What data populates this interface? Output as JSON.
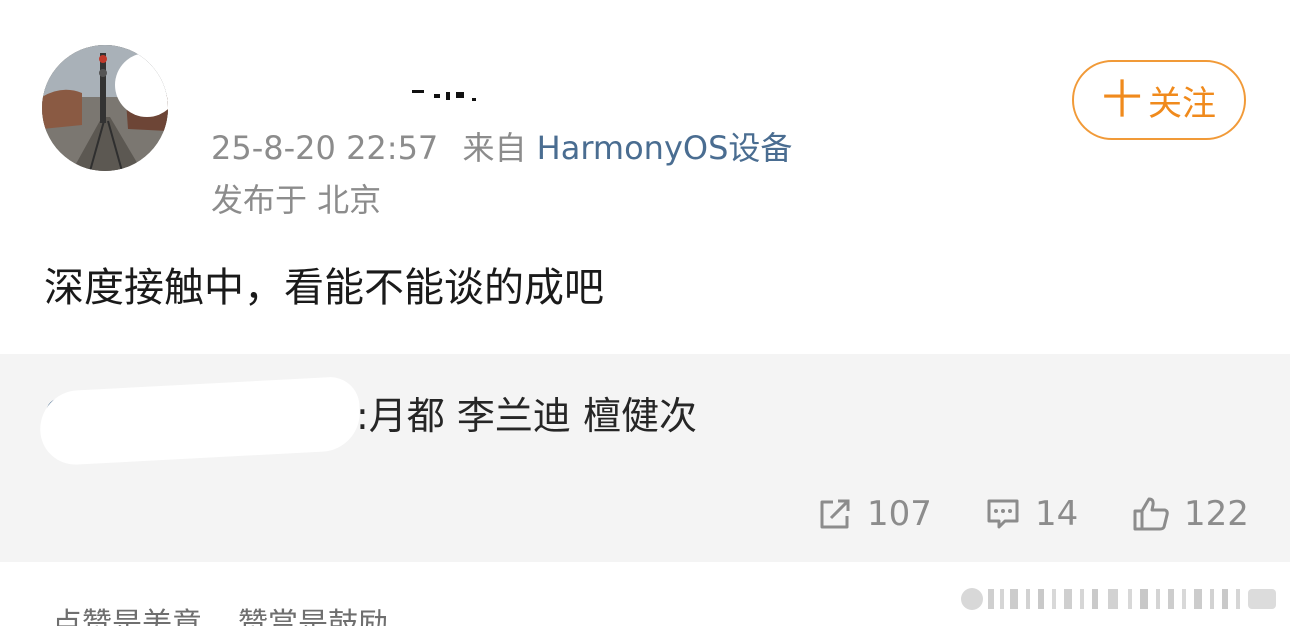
{
  "post": {
    "date": "25-8-20 22:57",
    "source_prefix": "来自",
    "source": "HarmonyOS设备",
    "location": "发布于 北京",
    "follow_label": "十关注",
    "follow_plus": "十",
    "follow_text": "关注",
    "content": "深度接触中，看能不能谈的成吧"
  },
  "retweet": {
    "text": ":月都 李兰迪 檀健次"
  },
  "actions": {
    "repost_count": "107",
    "comment_count": "14",
    "like_count": "122"
  },
  "footer": {
    "tip1": "点赞是美意",
    "tip2": "赞赏是鼓励"
  },
  "colors": {
    "accent": "#f08a1c",
    "link": "#4a6d91",
    "muted": "#8c8c8c",
    "retweet_bg": "#f4f4f4"
  }
}
